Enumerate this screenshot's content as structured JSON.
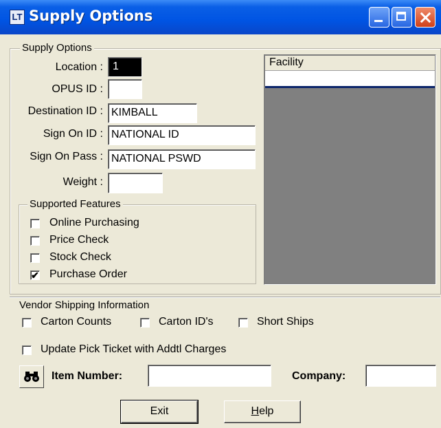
{
  "window": {
    "title": "Supply Options",
    "icon": "app-icon"
  },
  "supply_options": {
    "group_title": "Supply Options",
    "location": {
      "label": "Location :",
      "value": "1"
    },
    "opus_id": {
      "label": "OPUS ID :",
      "value": ""
    },
    "destination_id": {
      "label": "Destination ID :",
      "value": "KIMBALL"
    },
    "sign_on_id": {
      "label": "Sign On ID :",
      "value": "NATIONAL ID"
    },
    "sign_on_pass": {
      "label": "Sign On Pass :",
      "value": "NATIONAL PSWD"
    },
    "weight": {
      "label": "Weight :",
      "value": ""
    }
  },
  "supported_features": {
    "group_title": "Supported Features",
    "items": [
      {
        "label": "Online Purchasing",
        "checked": false
      },
      {
        "label": "Price Check",
        "checked": false
      },
      {
        "label": "Stock Check",
        "checked": false
      },
      {
        "label": "Purchase Order",
        "checked": true
      }
    ]
  },
  "facility_list": {
    "column_header": "Facility",
    "rows": [
      ""
    ]
  },
  "vendor_shipping": {
    "group_title": "Vendor Shipping Information",
    "options": [
      {
        "label": "Carton Counts",
        "checked": false
      },
      {
        "label": "Carton ID's",
        "checked": false
      },
      {
        "label": "Short Ships",
        "checked": false
      }
    ],
    "update_pick_ticket": {
      "label": "Update Pick Ticket with Addtl Charges",
      "checked": false
    }
  },
  "item_lookup": {
    "item_number_label": "Item Number:",
    "item_number_value": "",
    "company_label": "Company:",
    "company_value": "",
    "find_icon": "binoculars-icon"
  },
  "buttons": {
    "exit": "Exit",
    "help_prefix": "H",
    "help_rest": "elp"
  }
}
